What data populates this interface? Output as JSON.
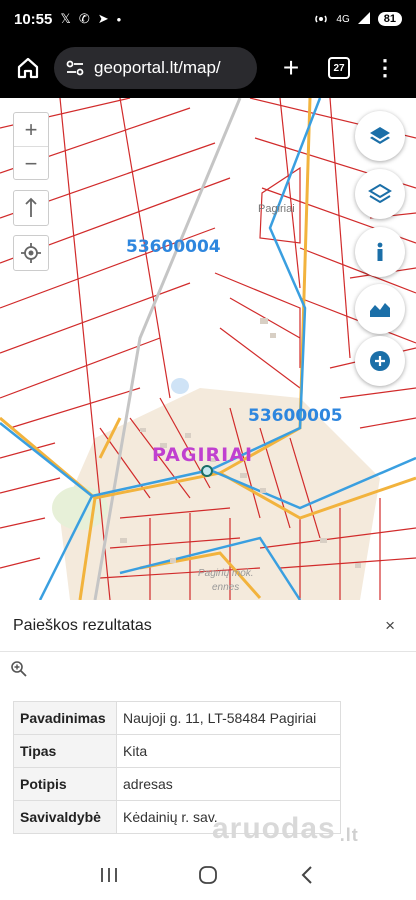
{
  "status": {
    "time": "10:55",
    "battery": "81",
    "network": "4G"
  },
  "browser": {
    "url": "geoportal.lt/map/",
    "tab_count": "27"
  },
  "map": {
    "zoom_in": "+",
    "zoom_out": "−",
    "labels": {
      "parcel_1": "53600004",
      "parcel_2": "53600005",
      "village_main": "PAGIRIAI",
      "village_small": "Pagiriai",
      "place_1": "Pagirių mok.",
      "place_2": "ennes"
    },
    "colors": {
      "parcel": "#d12b2b",
      "road": "#f2b33d",
      "boundary": "#3a9fe0",
      "label": "#2e86de",
      "village": "#c040d0"
    }
  },
  "panel": {
    "title": "Paieškos rezultatas",
    "close": "×",
    "rows": [
      {
        "key": "Pavadinimas",
        "value": "Naujoji g. 11, LT-58484 Pagiriai"
      },
      {
        "key": "Tipas",
        "value": "Kita"
      },
      {
        "key": "Potipis",
        "value": "adresas"
      },
      {
        "key": "Savivaldybė",
        "value": "Kėdainių r. sav."
      }
    ]
  },
  "watermark": {
    "brand": "aruodas",
    "tld": ".lt"
  }
}
